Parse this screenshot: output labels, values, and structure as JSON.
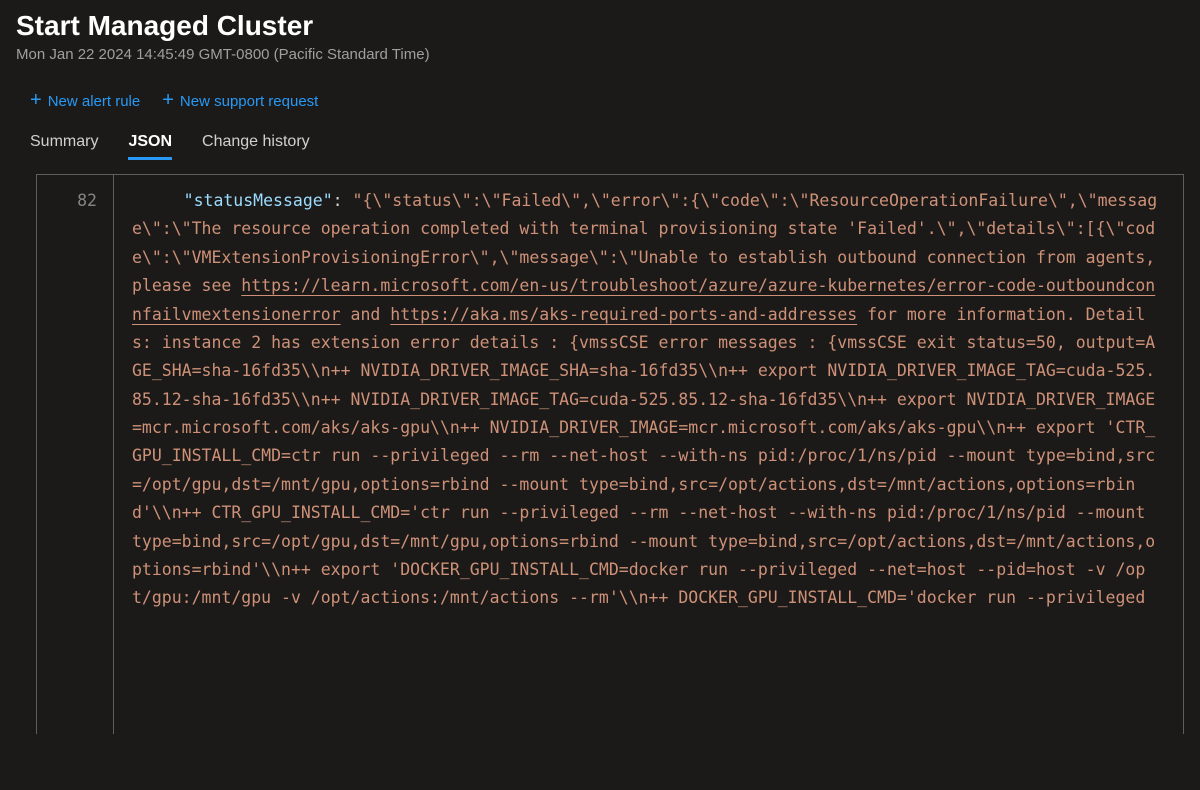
{
  "header": {
    "title": "Start Managed Cluster",
    "timestamp": "Mon Jan 22 2024 14:45:49 GMT-0800 (Pacific Standard Time)"
  },
  "toolbar": {
    "new_alert_rule": "New alert rule",
    "new_support_request": "New support request"
  },
  "tabs": {
    "summary": "Summary",
    "json": "JSON",
    "change_history": "Change history",
    "active": "json"
  },
  "code": {
    "line_number": "82",
    "json_key": "\"statusMessage\"",
    "colon_space": ": ",
    "seg1": "\"{\\\"status\\\":\\\"Failed\\\",\\\"error\\\":{\\\"code\\\":\\\"ResourceOperationFailure\\\",\\\"message\\\":\\\"The resource operation completed with terminal provisioning state 'Failed'.\\\",\\\"details\\\":[{\\\"code\\\":\\\"VMExtensionProvisioningError\\\",\\\"message\\\":\\\"Unable to establish outbound connection from agents, please see ",
    "link1": "https://learn.microsoft.com/en-us/troubleshoot/azure/azure-kubernetes/error-code-outboundconnfailvmextensionerror",
    "seg2": " and ",
    "link2": "https://aka.ms/aks-required-ports-and-addresses",
    "seg3": " for more information. Details: instance 2 has extension error details : {vmssCSE error messages : {vmssCSE exit status=50, output=AGE_SHA=sha-16fd35\\\\n++ NVIDIA_DRIVER_IMAGE_SHA=sha-16fd35\\\\n++ export NVIDIA_DRIVER_IMAGE_TAG=cuda-525.85.12-sha-16fd35\\\\n++ NVIDIA_DRIVER_IMAGE_TAG=cuda-525.85.12-sha-16fd35\\\\n++ export NVIDIA_DRIVER_IMAGE=mcr.microsoft.com/aks/aks-gpu\\\\n++ NVIDIA_DRIVER_IMAGE=mcr.microsoft.com/aks/aks-gpu\\\\n++ export 'CTR_GPU_INSTALL_CMD=ctr run --privileged --rm --net-host --with-ns pid:/proc/1/ns/pid --mount type=bind,src=/opt/gpu,dst=/mnt/gpu,options=rbind --mount type=bind,src=/opt/actions,dst=/mnt/actions,options=rbind'\\\\n++ CTR_GPU_INSTALL_CMD='ctr run --privileged --rm --net-host --with-ns pid:/proc/1/ns/pid --mount type=bind,src=/opt/gpu,dst=/mnt/gpu,options=rbind --mount type=bind,src=/opt/actions,dst=/mnt/actions,options=rbind'\\\\n++ export 'DOCKER_GPU_INSTALL_CMD=docker run --privileged --net=host --pid=host -v /opt/gpu:/mnt/gpu -v /opt/actions:/mnt/actions --rm'\\\\n++ DOCKER_GPU_INSTALL_CMD='docker run --privileged"
  }
}
